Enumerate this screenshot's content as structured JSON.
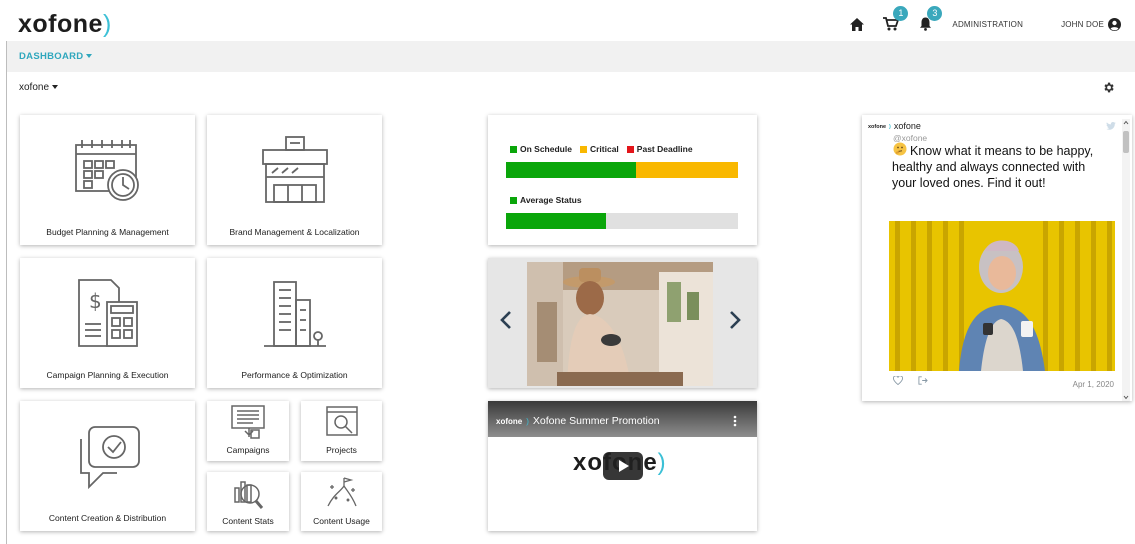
{
  "header": {
    "brand": "xofone",
    "cart_count": "1",
    "notification_count": "3",
    "admin_label": "ADMINISTRATION",
    "user_label": "JOHN DOE"
  },
  "subnav": {
    "dashboard_label": "DASHBOARD"
  },
  "org_selector": {
    "value": "xofone"
  },
  "tiles": {
    "budget": "Budget Planning & Management",
    "brand": "Brand Management & Localization",
    "campaign_planning": "Campaign Planning & Execution",
    "performance": "Performance & Optimization",
    "content_creation": "Content Creation & Distribution",
    "campaigns": "Campaigns",
    "projects": "Projects",
    "content_stats": "Content Stats",
    "content_usage": "Content Usage"
  },
  "status_widget": {
    "legend": [
      "On Schedule",
      "Critical",
      "Past Deadline"
    ],
    "colors": {
      "on_schedule": "#0aa60a",
      "critical": "#f9b800",
      "past_deadline": "#e3151a",
      "track": "#dedede"
    },
    "status_bar": {
      "on_schedule": 0.56,
      "critical": 0.44,
      "past_deadline": 0.0
    },
    "average_label": "Average Status",
    "average_value": 0.43
  },
  "video": {
    "brand_mini": "xofone",
    "title": "Xofone Summer Promotion",
    "logo_text": "xofone"
  },
  "tweet": {
    "brand_mini": "xofone",
    "author": "xofone",
    "handle": "@xofone",
    "text": "Know what it means to be happy, healthy and always connected with your loved ones. Find it out!",
    "date": "Apr 1, 2020"
  },
  "accent_color": "#2fa7bd"
}
